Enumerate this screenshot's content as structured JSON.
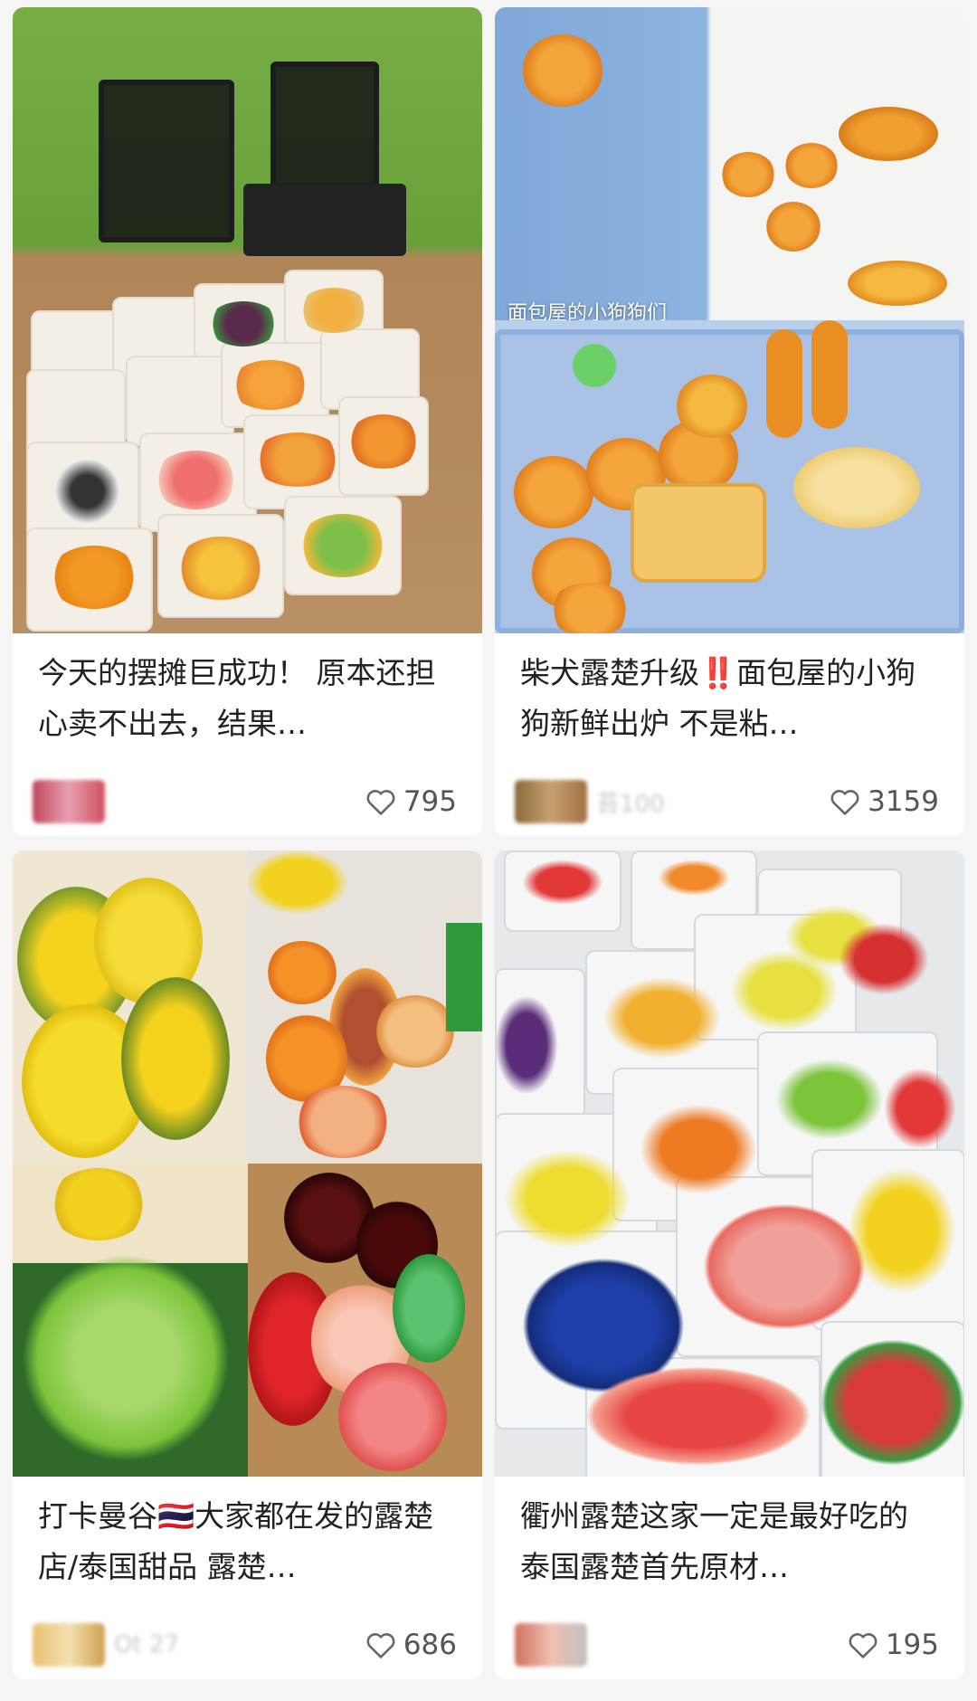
{
  "cards": [
    {
      "title": "今天的摆摊巨成功！ 原本还担心卖不出去，结果…",
      "author": "",
      "likes": "795",
      "image_caption": "",
      "colors": {
        "bg": "#6aa23a",
        "table": "#b38a5c"
      }
    },
    {
      "title": "柴犬露楚升级‼️面包屋的小狗狗新鲜出炉 不是粘…",
      "author": "苔100",
      "likes": "3159",
      "image_caption": "面包屋的小狗狗们",
      "colors": {
        "bg": "#8fb4df",
        "accent": "#f2a23a"
      }
    },
    {
      "title": "打卡曼谷🇹🇭大家都在发的露楚店/泰国甜品 露楚…",
      "author": "Ot 27",
      "likes": "686",
      "image_caption": "",
      "colors": {
        "yellow": "#f2d21e",
        "green": "#7cc43a"
      }
    },
    {
      "title": "衢州露楚这家一定是最好吃的 泰国露楚首先原材…",
      "author": "",
      "likes": "195",
      "image_caption": "",
      "colors": {
        "bg": "#e9ecef",
        "blue": "#1e3fa8"
      }
    }
  ]
}
